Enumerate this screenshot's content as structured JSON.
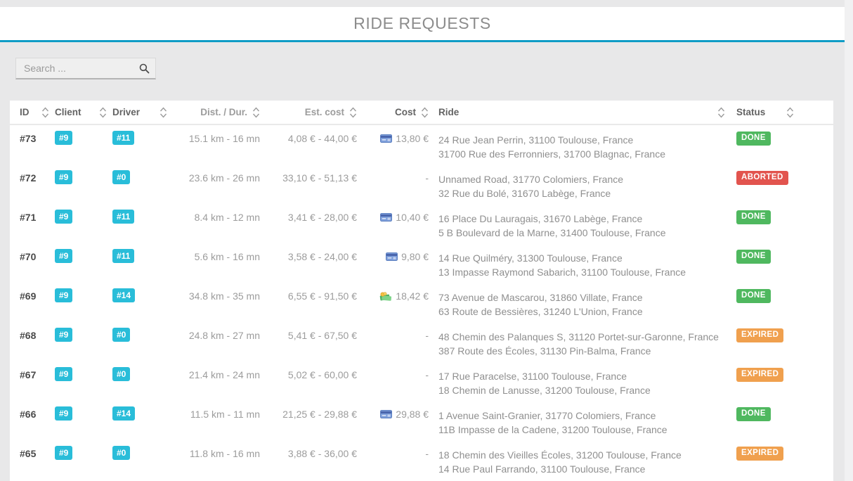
{
  "header": {
    "title": "RIDE REQUESTS"
  },
  "search": {
    "placeholder": "Search ...",
    "value": "",
    "icon": "magnifier-icon"
  },
  "colors": {
    "accent_line": "#0f9cc6",
    "badge_cyan": "#29bdd9",
    "status_done": "#4fb85f",
    "status_aborted": "#e2544e",
    "status_expired": "#f0a04e",
    "page_background": "#e8e8e9"
  },
  "table": {
    "columns": [
      {
        "label": "ID"
      },
      {
        "label": "Client"
      },
      {
        "label": "Driver"
      },
      {
        "label": "Dist. / Dur."
      },
      {
        "label": "Est. cost"
      },
      {
        "label": "Cost"
      },
      {
        "label": "Ride"
      },
      {
        "label": "Status"
      }
    ],
    "sort_icon": "sort-chevrons-icon",
    "payment_icons": {
      "card": "credit-card-icon",
      "cash": "cash-icon"
    },
    "rows": [
      {
        "id": "#73",
        "client": "#9",
        "driver": "#11",
        "dist": "15.1 km - 16 mn",
        "est": "4,08 € - 44,00 €",
        "cost": "13,80 €",
        "payment": "card",
        "from": "24 Rue Jean Perrin, 31100 Toulouse, France",
        "to": "31700 Rue des Ferronniers, 31700 Blagnac, France",
        "status": "DONE"
      },
      {
        "id": "#72",
        "client": "#9",
        "driver": "#0",
        "dist": "23.6 km - 26 mn",
        "est": "33,10 € - 51,13 €",
        "cost": "-",
        "payment": "",
        "from": "Unnamed Road, 31770 Colomiers, France",
        "to": "32 Rue du Bolé, 31670 Labège, France",
        "status": "ABORTED"
      },
      {
        "id": "#71",
        "client": "#9",
        "driver": "#11",
        "dist": "8.4 km - 12 mn",
        "est": "3,41 € - 28,00 €",
        "cost": "10,40 €",
        "payment": "card",
        "from": "16 Place Du Lauragais, 31670 Labège, France",
        "to": "5 B Boulevard de la Marne, 31400 Toulouse, France",
        "status": "DONE"
      },
      {
        "id": "#70",
        "client": "#9",
        "driver": "#11",
        "dist": "5.6 km - 16 mn",
        "est": "3,58 € - 24,00 €",
        "cost": "9,80 €",
        "payment": "card",
        "from": "14 Rue Quilméry, 31300 Toulouse, France",
        "to": "13 Impasse Raymond Sabarich, 31100 Toulouse, France",
        "status": "DONE"
      },
      {
        "id": "#69",
        "client": "#9",
        "driver": "#14",
        "dist": "34.8 km - 35 mn",
        "est": "6,55 € - 91,50 €",
        "cost": "18,42 €",
        "payment": "cash",
        "from": "73 Avenue de Mascarou, 31860 Villate, France",
        "to": "63 Route de Bessières, 31240 L'Union, France",
        "status": "DONE"
      },
      {
        "id": "#68",
        "client": "#9",
        "driver": "#0",
        "dist": "24.8 km - 27 mn",
        "est": "5,41 € - 67,50 €",
        "cost": "-",
        "payment": "",
        "from": "48 Chemin des Palanques S, 31120 Portet-sur-Garonne, France",
        "to": "387 Route des Écoles, 31130 Pin-Balma, France",
        "status": "EXPIRED"
      },
      {
        "id": "#67",
        "client": "#9",
        "driver": "#0",
        "dist": "21.4 km - 24 mn",
        "est": "5,02 € - 60,00 €",
        "cost": "-",
        "payment": "",
        "from": "17 Rue Paracelse, 31100 Toulouse, France",
        "to": "18 Chemin de Lanusse, 31200 Toulouse, France",
        "status": "EXPIRED"
      },
      {
        "id": "#66",
        "client": "#9",
        "driver": "#14",
        "dist": "11.5 km - 11 mn",
        "est": "21,25 € - 29,88 €",
        "cost": "29,88 €",
        "payment": "card",
        "from": "1 Avenue Saint-Granier, 31770 Colomiers, France",
        "to": "11B Impasse de la Cadene, 31200 Toulouse, France",
        "status": "DONE"
      },
      {
        "id": "#65",
        "client": "#9",
        "driver": "#0",
        "dist": "11.8 km - 16 mn",
        "est": "3,88 € - 36,00 €",
        "cost": "-",
        "payment": "",
        "from": "18 Chemin des Vieilles Écoles, 31200 Toulouse, France",
        "to": "14 Rue Paul Farrando, 31100 Toulouse, France",
        "status": "EXPIRED"
      }
    ]
  }
}
